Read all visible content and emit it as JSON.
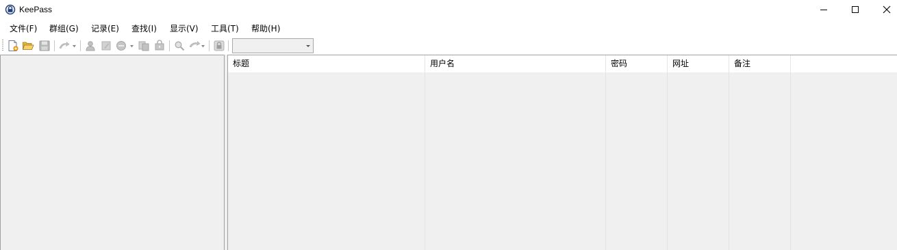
{
  "window": {
    "title": "KeePass"
  },
  "menu": [
    {
      "label": "文件(F)"
    },
    {
      "label": "群组(G)"
    },
    {
      "label": "记录(E)"
    },
    {
      "label": "查找(I)"
    },
    {
      "label": "显示(V)"
    },
    {
      "label": "工具(T)"
    },
    {
      "label": "帮助(H)"
    }
  ],
  "toolbar": {
    "buttons": [
      {
        "icon": "new-database-icon"
      },
      {
        "icon": "open-database-icon"
      },
      {
        "icon": "save-icon"
      },
      {
        "icon": "sync-icon"
      },
      {
        "icon": "add-entry-icon"
      },
      {
        "icon": "edit-entry-icon"
      },
      {
        "icon": "delete-entry-icon"
      },
      {
        "icon": "copy-username-icon"
      },
      {
        "icon": "copy-password-icon"
      },
      {
        "icon": "find-icon"
      },
      {
        "icon": "entries-icon"
      },
      {
        "icon": "lock-icon"
      }
    ],
    "quick_search_value": ""
  },
  "entry_list": {
    "columns": [
      {
        "label": "标题"
      },
      {
        "label": "用户名"
      },
      {
        "label": "密码"
      },
      {
        "label": "网址"
      },
      {
        "label": "备注"
      }
    ],
    "rows": []
  },
  "colors": {
    "panel_bg": "#f0f0f0",
    "accent": "#1e3c78"
  }
}
